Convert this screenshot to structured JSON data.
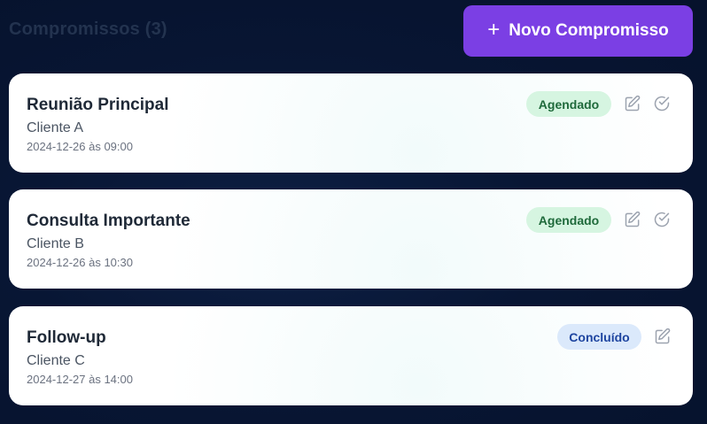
{
  "header": {
    "title": "Compromissos (3)",
    "new_button_label": "Novo Compromisso",
    "new_button_icon": "plus-icon"
  },
  "colors": {
    "background": "#06122c",
    "accent": "#7b3fe4",
    "badge_scheduled_bg": "#d6f5e1",
    "badge_scheduled_text": "#1f6a3b",
    "badge_done_bg": "#dbe9fb",
    "badge_done_text": "#1e45a0"
  },
  "appointments": [
    {
      "title": "Reunião Principal",
      "client": "Cliente A",
      "datetime": "2024-12-26 às 09:00",
      "status": "Agendado",
      "actions": [
        "edit-icon",
        "check-circle-icon"
      ]
    },
    {
      "title": "Consulta Importante",
      "client": "Cliente B",
      "datetime": "2024-12-26 às 10:30",
      "status": "Agendado",
      "actions": [
        "edit-icon",
        "check-circle-icon"
      ]
    },
    {
      "title": "Follow-up",
      "client": "Cliente C",
      "datetime": "2024-12-27 às 14:00",
      "status": "Concluído",
      "actions": [
        "edit-icon"
      ]
    }
  ]
}
